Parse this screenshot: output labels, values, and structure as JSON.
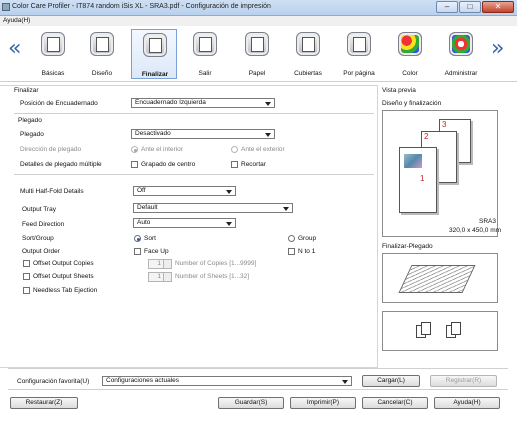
{
  "window": {
    "title": "Color Care Profiler - IT874 random iSis XL - SRA3.pdf - Configuración de impresión"
  },
  "menu": {
    "help": "Ayuda(H)"
  },
  "tabs": [
    {
      "label": "Básicas"
    },
    {
      "label": "Diseño"
    },
    {
      "label": "Finalizar"
    },
    {
      "label": "Salir"
    },
    {
      "label": "Papel"
    },
    {
      "label": "Cubiertas"
    },
    {
      "label": "Por página"
    },
    {
      "label": "Color"
    },
    {
      "label": "Administrar"
    }
  ],
  "finish": {
    "group_title": "Finalizar",
    "binding_label": "Posición de Encuadernado",
    "binding_value": "Encuadernado Izquierda",
    "fold_group_title": "Plegado",
    "fold_label": "Plegado",
    "fold_value": "Desactivado",
    "fold_direction_label": "Dirección de plegado",
    "fold_inside": "Ante el interior",
    "fold_outside": "Ante el exterior",
    "multi_fold_details_label": "Detalles de plegado múltiple",
    "center_crease": "Grapado de centro",
    "trim": "Recortar",
    "multi_half_fold_label": "Multi Half-Fold Details",
    "multi_half_fold_value": "Off",
    "output_tray_label": "Output Tray",
    "output_tray_value": "Default",
    "feed_direction_label": "Feed Direction",
    "feed_direction_value": "Auto",
    "sort_group_label": "Sort/Group",
    "sort": "Sort",
    "group": "Group",
    "output_order_label": "Output Order",
    "face_up": "Face Up",
    "n_to_1": "N to 1",
    "offset_copies": "Offset Output Copies",
    "copies_value": "1",
    "copies_range": "Number of Copies [1...9999]",
    "offset_sheets": "Offset Output Sheets",
    "sheets_value": "1",
    "sheets_range": "Number of Sheets [1...32]",
    "needless_tab": "Needless Tab Ejection"
  },
  "preview": {
    "title": "Vista previa",
    "layout_title": "Diseño y finalización",
    "page_numbers": [
      "1",
      "2",
      "3"
    ],
    "paper_name": "SRA3",
    "paper_size": "320,0 x 450,0 mm",
    "fold_title": "Finalizar-Plegado"
  },
  "favorites": {
    "label": "Configuración favorita(U)",
    "value": "Configuraciones actuales",
    "load": "Cargar(L)",
    "register": "Registrar(R)"
  },
  "footer": {
    "restore": "Restaurar(Z)",
    "save": "Guardar(S)",
    "print": "Imprimir(P)",
    "cancel": "Cancelar(C)",
    "help": "Ayuda(H)"
  }
}
